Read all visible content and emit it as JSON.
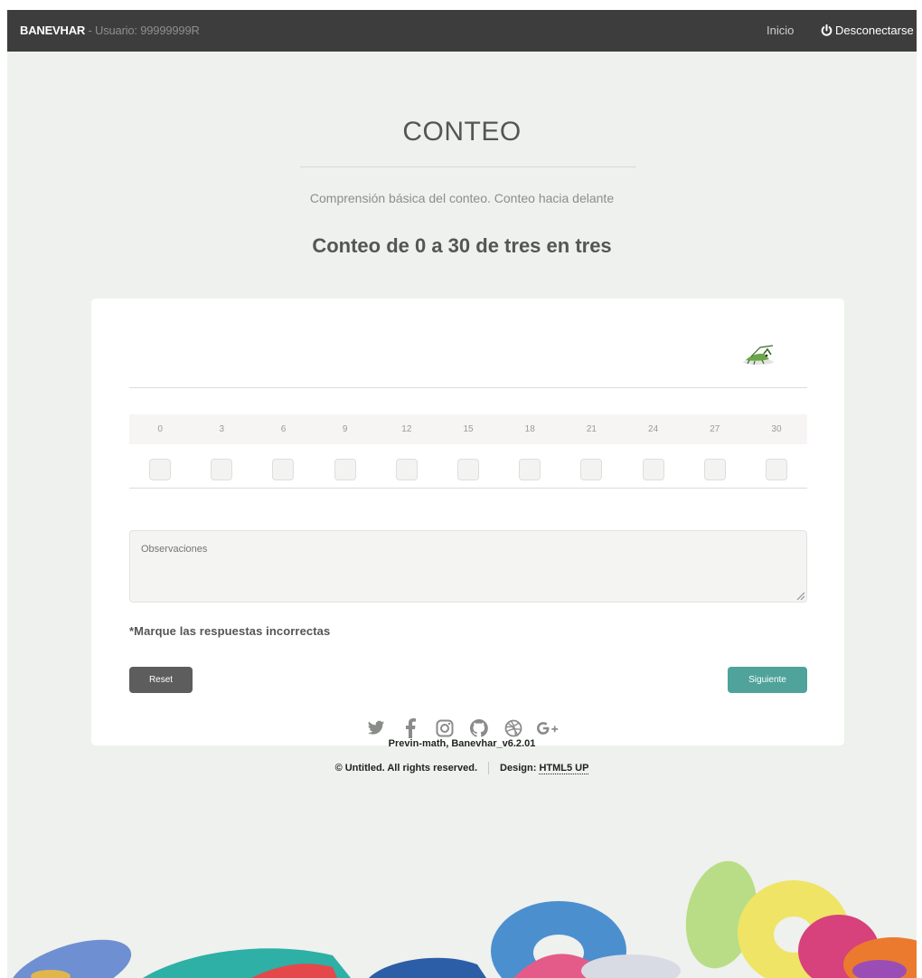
{
  "topbar": {
    "brand_name": "BANEVHAR",
    "user_text": " - Usuario: 99999999R",
    "nav_home": "Inicio",
    "nav_logout": "Desconectarse"
  },
  "header": {
    "title": "CONTEO",
    "subtitle": "Comprensión básica del conteo. Conteo hacia delante",
    "heading": "Conteo de 0 a 30 de tres en tres"
  },
  "exercise": {
    "image": "cricket-icon",
    "numbers": [
      "0",
      "3",
      "6",
      "9",
      "12",
      "15",
      "18",
      "21",
      "24",
      "27",
      "30"
    ],
    "checked": [
      false,
      false,
      false,
      false,
      false,
      false,
      false,
      false,
      false,
      false,
      false
    ],
    "observations_placeholder": "Observaciones",
    "note": "*Marque las respuestas incorrectas",
    "reset_label": "Reset",
    "next_label": "Siguiente"
  },
  "footer": {
    "social_icons": [
      "twitter-icon",
      "facebook-icon",
      "instagram-icon",
      "github-icon",
      "dribbble-icon",
      "google-plus-icon"
    ],
    "version": "Previn-math, Banevhar_v6.2.01",
    "copyright": "© Untitled. All rights reserved.",
    "design_label": "Design: ",
    "design_link": "HTML5 UP"
  },
  "colors": {
    "topbar": "#3d3d3d",
    "page_bg": "#eef1ed",
    "reset_button": "#5d5d5d",
    "next_button": "#4fa39a"
  }
}
